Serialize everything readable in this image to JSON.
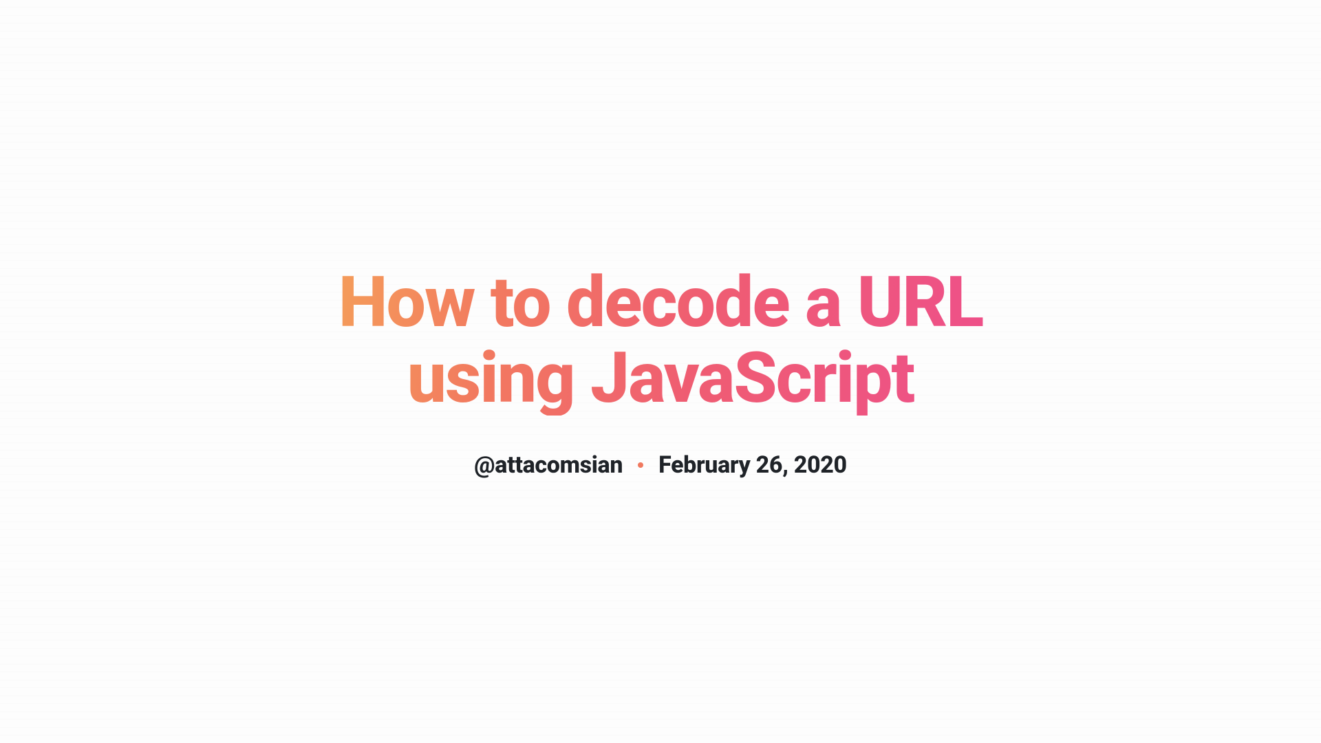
{
  "article": {
    "title": "How to decode a URL using JavaScript",
    "author_handle": "@attacomsian",
    "date": "February 26, 2020"
  }
}
